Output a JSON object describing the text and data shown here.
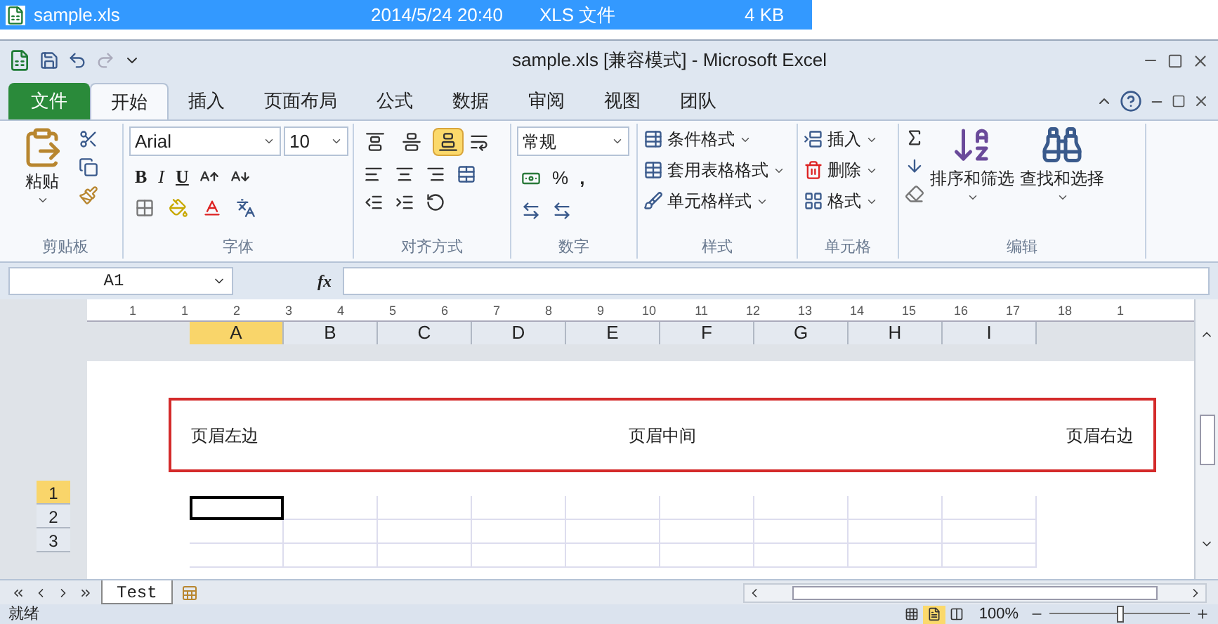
{
  "file_row": {
    "name": "sample.xls",
    "date": "2014/5/24 20:40",
    "type": "XLS 文件",
    "size": "4 KB"
  },
  "window": {
    "title": "sample.xls  [兼容模式]  -  Microsoft Excel"
  },
  "tabs": [
    {
      "label": "文件",
      "kind": "file",
      "selected": false
    },
    {
      "label": "开始",
      "kind": "tab",
      "selected": true
    },
    {
      "label": "插入",
      "kind": "tab",
      "selected": false
    },
    {
      "label": "页面布局",
      "kind": "tab",
      "selected": false
    },
    {
      "label": "公式",
      "kind": "tab",
      "selected": false
    },
    {
      "label": "数据",
      "kind": "tab",
      "selected": false
    },
    {
      "label": "审阅",
      "kind": "tab",
      "selected": false
    },
    {
      "label": "视图",
      "kind": "tab",
      "selected": false
    },
    {
      "label": "团队",
      "kind": "tab",
      "selected": false
    }
  ],
  "ribbon": {
    "paste": "粘贴",
    "font": "Arial",
    "font_size": "10",
    "bold": "B",
    "italic": "I",
    "underline": "U",
    "valign": [
      {
        "kind": "top",
        "selected": false
      },
      {
        "kind": "middle",
        "selected": false
      },
      {
        "kind": "bottom",
        "selected": true
      }
    ],
    "number_format": "常规",
    "percent": "%",
    "comma": ",",
    "styles": [
      "条件格式",
      "套用表格格式",
      "单元格样式"
    ],
    "cells": [
      "插入",
      "删除",
      "格式"
    ],
    "sort": "排序和筛选",
    "find": "查找和选择",
    "groups": [
      "剪贴板",
      "字体",
      "对齐方式",
      "数字",
      "样式",
      "单元格",
      "编辑"
    ]
  },
  "formula_bar": {
    "name_box": "A1",
    "fx": "fx"
  },
  "ruler": [
    "1",
    "1",
    "2",
    "3",
    "4",
    "5",
    "6",
    "7",
    "8",
    "9",
    "10",
    "11",
    "12",
    "13",
    "14",
    "15",
    "16",
    "17",
    "18",
    "1"
  ],
  "columns": [
    {
      "label": "A",
      "selected": true
    },
    {
      "label": "B",
      "selected": false
    },
    {
      "label": "C",
      "selected": false
    },
    {
      "label": "D",
      "selected": false
    },
    {
      "label": "E",
      "selected": false
    },
    {
      "label": "F",
      "selected": false
    },
    {
      "label": "G",
      "selected": false
    },
    {
      "label": "H",
      "selected": false
    },
    {
      "label": "I",
      "selected": false
    }
  ],
  "rows": [
    {
      "label": "1",
      "selected": true
    },
    {
      "label": "2",
      "selected": false
    },
    {
      "label": "3",
      "selected": false
    }
  ],
  "page_header": {
    "left": "页眉左边",
    "center": "页眉中间",
    "right": "页眉右边"
  },
  "sheet_tabs": [
    {
      "label": "Test",
      "selected": true
    }
  ],
  "status_bar": {
    "text": "就绪",
    "views": [
      {
        "kind": "normal",
        "selected": false
      },
      {
        "kind": "layout",
        "selected": true
      },
      {
        "kind": "pagebreak",
        "selected": false
      }
    ],
    "zoom": "100%",
    "level": 0.5
  }
}
